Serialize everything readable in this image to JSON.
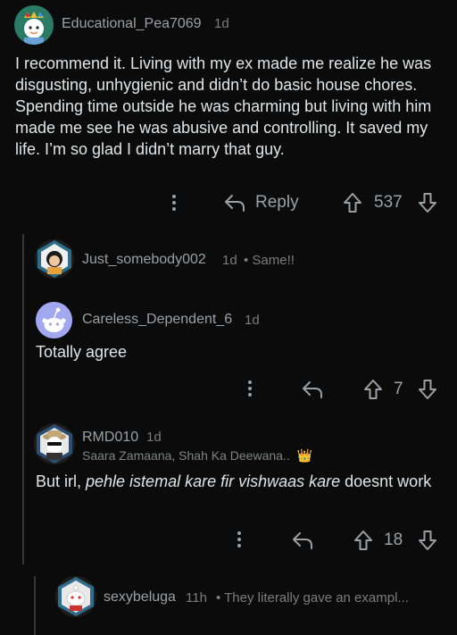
{
  "comments": [
    {
      "username": "Educational_Pea7069",
      "age": "1d",
      "body": "I recommend it. Living with my ex made me realize he was disgusting, unhygienic and didn’t do basic house chores. Spending time outside he was charming but living with him made me see he was abusive and controlling. It saved my life. I’m so glad I didn’t marry that guy.",
      "reply_label": "Reply",
      "score": "537"
    },
    {
      "username": "Just_somebody002",
      "age": "1d",
      "collapsed_preview": "• Same!!"
    },
    {
      "username": "Careless_Dependent_6",
      "age": "1d",
      "body": "Totally agree",
      "score": "7"
    },
    {
      "username": "RMD010",
      "age": "1d",
      "flair": "Saara Zamaana, Shah Ka Deewana..",
      "flair_emoji": "👑",
      "body_before": "But irl, ",
      "body_italic": "pehle istemal kare fir vishwaas kare",
      "body_after": " doesnt work",
      "score": "18"
    },
    {
      "username": "sexybeluga",
      "age": "11h",
      "collapsed_preview": "• They literally gave an exampl..."
    }
  ],
  "icons": {
    "more": "more-options-icon",
    "reply": "reply-arrow-icon",
    "upvote": "upvote-arrow-icon",
    "downvote": "downvote-arrow-icon"
  },
  "colors": {
    "background": "#0b0b0b",
    "text": "#d7dadc",
    "muted": "#9aa0a4",
    "thread_line": "#343536"
  }
}
